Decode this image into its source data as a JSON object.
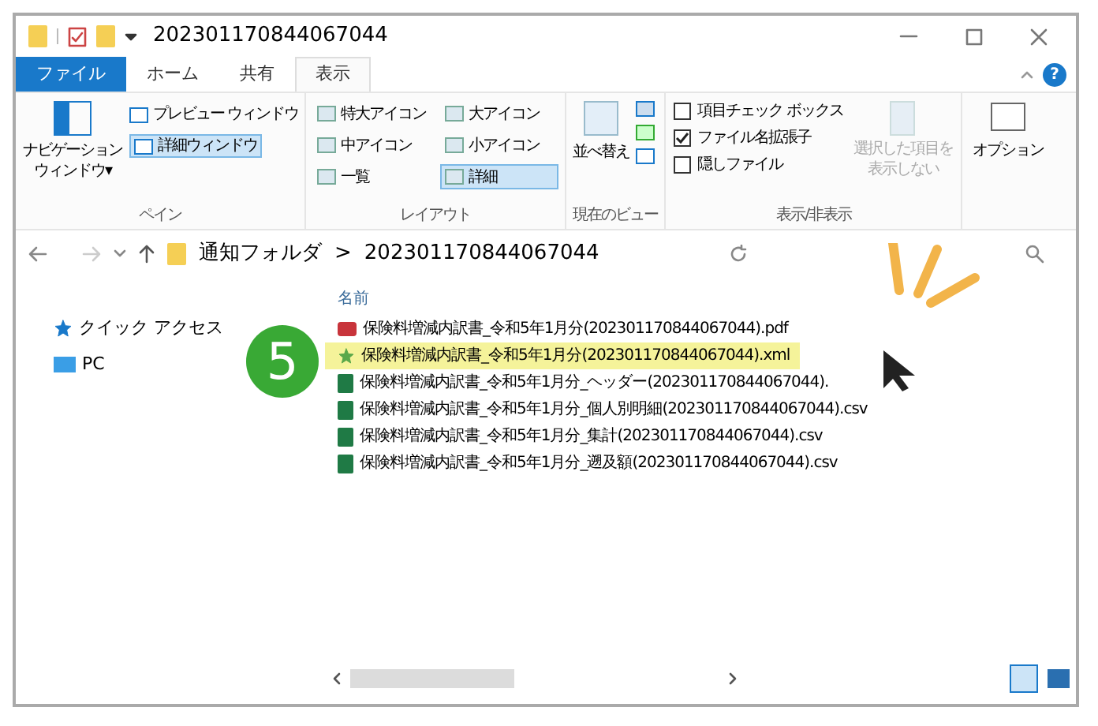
{
  "window": {
    "title": "202301170844067044",
    "help": "?"
  },
  "tabs": [
    {
      "label": "ファイル",
      "kind": "file",
      "selected": false
    },
    {
      "label": "ホーム",
      "kind": "tab",
      "selected": false
    },
    {
      "label": "共有",
      "kind": "tab",
      "selected": false
    },
    {
      "label": "表示",
      "kind": "tab",
      "selected": true
    }
  ],
  "ribbon": {
    "pane": {
      "nav": "ナビゲーションウィンドウ▾",
      "preview": "プレビュー ウィンドウ",
      "details": "詳細ウィンドウ",
      "details_selected": true,
      "label": "ペイン"
    },
    "layout": {
      "items": [
        {
          "label": "特大アイコン",
          "selected": false
        },
        {
          "label": "大アイコン",
          "selected": false
        },
        {
          "label": "中アイコン",
          "selected": false
        },
        {
          "label": "小アイコン",
          "selected": false
        },
        {
          "label": "一覧",
          "selected": false
        },
        {
          "label": "詳細",
          "selected": true
        }
      ],
      "label": "レイアウト"
    },
    "view": {
      "sort": "並べ替え",
      "label": "現在のビュー"
    },
    "show": {
      "checks": [
        {
          "label": "項目チェック ボックス",
          "checked": false
        },
        {
          "label": "ファイル名拡張子",
          "checked": true
        },
        {
          "label": "隠しファイル",
          "checked": false
        }
      ],
      "hide": "選択した項目を表示しない",
      "label": "表示/非表示"
    },
    "options": "オプション"
  },
  "address": {
    "folder": "通知フォルダ",
    "sep": ">",
    "current": "202301170844067044"
  },
  "sidebar": {
    "items": [
      {
        "label": "クイック アクセス",
        "kind": "star"
      },
      {
        "label": "PC",
        "kind": "pc"
      }
    ]
  },
  "list": {
    "header": "名前",
    "step": "5",
    "files": [
      {
        "name": "保険料増減内訳書_令和5年1月分(202301170844067044).pdf",
        "kind": "pdf",
        "selected": false
      },
      {
        "name": "保険料増減内訳書_令和5年1月分(202301170844067044).xml",
        "kind": "xml",
        "selected": true
      },
      {
        "name": "保険料増減内訳書_令和5年1月分_ヘッダー(202301170844067044).",
        "kind": "csv",
        "selected": false
      },
      {
        "name": "保険料増減内訳書_令和5年1月分_個人別明細(202301170844067044).csv",
        "kind": "csv",
        "selected": false
      },
      {
        "name": "保険料増減内訳書_令和5年1月分_集計(202301170844067044).csv",
        "kind": "csv",
        "selected": false
      },
      {
        "name": "保険料増減内訳書_令和5年1月分_遡及額(202301170844067044).csv",
        "kind": "csv",
        "selected": false
      }
    ]
  }
}
